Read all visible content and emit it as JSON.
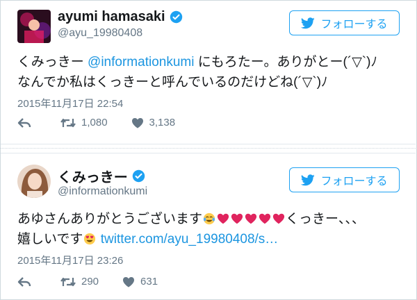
{
  "tweets": [
    {
      "name": "ayumi hamasaki",
      "handle": "@ayu_19980408",
      "follow_label": "フォローする",
      "text_pre": "くみっきー ",
      "mention": "@informationkumi",
      "text_post": " にもろたー。ありがとー(´▽`)ﾉ",
      "line2": "なんでか私はくっきーと呼んでいるのだけどね(´▽`)ﾉ",
      "date": "2015年11月17日 22:54",
      "retweets": "1,080",
      "likes": "3,138"
    },
    {
      "name": "くみっきー",
      "handle": "@informationkumi",
      "follow_label": "フォローする",
      "text_pre": "あゆさんありがとうございます",
      "text_post": "くっきー、、、",
      "line2_pre": "嬉しいです",
      "link": "twitter.com/ayu_19980408/s…",
      "date": "2015年11月17日 23:26",
      "retweets": "290",
      "likes": "631"
    }
  ],
  "icons": [
    "verified-badge-icon",
    "twitter-bird-icon",
    "reply-icon",
    "retweet-icon",
    "heart-icon",
    "tears-of-joy-emoji",
    "heart-emoji",
    "heart-eyes-emoji"
  ],
  "colors": {
    "accent": "#1da1f2",
    "link": "#1b95e0",
    "meta": "#657786",
    "heart_emoji": "#e0245e"
  }
}
